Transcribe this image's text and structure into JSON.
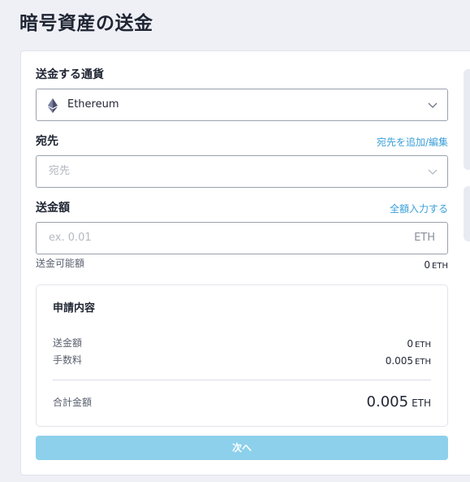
{
  "page": {
    "title": "暗号資産の送金"
  },
  "currency": {
    "label": "送金する通貨",
    "selected": "Ethereum",
    "icon": "ethereum-icon"
  },
  "destination": {
    "label": "宛先",
    "link": "宛先を追加/編集",
    "placeholder": "宛先"
  },
  "amount": {
    "label": "送金額",
    "link": "全額入力する",
    "placeholder": "ex. 0.01",
    "unit": "ETH",
    "available_label": "送金可能額",
    "available_value": "0",
    "available_unit": "ETH"
  },
  "summary": {
    "title": "申請内容",
    "rows": [
      {
        "label": "送金額",
        "value": "0",
        "unit": "ETH"
      },
      {
        "label": "手数料",
        "value": "0.005",
        "unit": "ETH"
      }
    ],
    "total_label": "合計金額",
    "total_value": "0.005",
    "total_unit": "ETH"
  },
  "actions": {
    "next_label": "次へ"
  },
  "colors": {
    "accent": "#3aa0d8",
    "button_disabled": "#8dd0ec",
    "background": "#eef0f6"
  }
}
